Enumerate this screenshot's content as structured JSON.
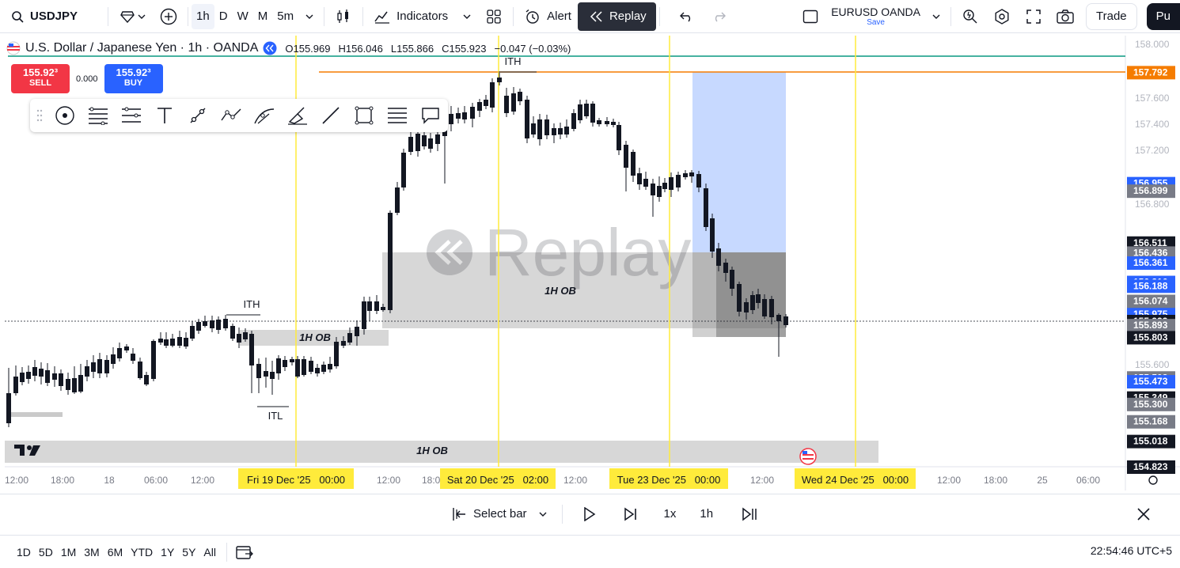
{
  "topbar": {
    "symbol": "USDJPY",
    "timeframes": [
      "1h",
      "D",
      "W",
      "M",
      "5m"
    ],
    "indicators_label": "Indicators",
    "alert_label": "Alert",
    "replay_label": "Replay",
    "compare_symbol": "EURUSD OANDA",
    "compare_save": "Save",
    "trade_label": "Trade",
    "publish_label": "Pu"
  },
  "legend": {
    "title": "U.S. Dollar / Japanese Yen · 1h · OANDA",
    "open": "O155.969",
    "high": "H156.046",
    "low": "L155.866",
    "close": "C155.923",
    "change": "−0.047 (−0.03%)"
  },
  "order": {
    "sell_price": "155.92³",
    "sell_label": "SELL",
    "spread": "0.000",
    "buy_price": "155.92³",
    "buy_label": "BUY"
  },
  "watermark": "Replay",
  "chart_data": {
    "type": "candlestick",
    "ylim": [
      154.823,
      158.0
    ],
    "y_ticks": [
      "158.000",
      "157.600",
      "157.400",
      "157.200",
      "156.800",
      "155.600"
    ],
    "price_labels": [
      {
        "value": "157.792",
        "color": "#f57c00"
      },
      {
        "value": "156.955",
        "color": "#2962ff"
      },
      {
        "value": "156.899",
        "color": "#787b86"
      },
      {
        "value": "156.511",
        "color": "#131722"
      },
      {
        "value": "156.436",
        "color": "#787b86"
      },
      {
        "value": "156.361",
        "color": "#2962ff"
      },
      {
        "value": "156.216",
        "color": "#2962ff"
      },
      {
        "value": "156.188",
        "color": "#2962ff"
      },
      {
        "value": "156.074",
        "color": "#787b86"
      },
      {
        "value": "155.975",
        "color": "#2962ff"
      },
      {
        "value": "155.923",
        "color": "#131722"
      },
      {
        "value": "155.893",
        "color": "#787b86"
      },
      {
        "value": "155.803",
        "color": "#131722"
      },
      {
        "value": "155.502",
        "color": "#787b86"
      },
      {
        "value": "155.473",
        "color": "#2962ff"
      },
      {
        "value": "155.349",
        "color": "#131722"
      },
      {
        "value": "155.300",
        "color": "#787b86"
      },
      {
        "value": "155.168",
        "color": "#787b86"
      },
      {
        "value": "155.018",
        "color": "#131722"
      },
      {
        "value": "154.823",
        "color": "#131722"
      }
    ],
    "x_ticks": [
      "12:00",
      "18:00",
      "18",
      "06:00",
      "12:00",
      "12:00",
      "18:00",
      "12:00",
      "12:00",
      "12:00",
      "18:00",
      "25",
      "06:00"
    ],
    "highlighted_dates": [
      "Fri 19 Dec '25   00:00",
      "Sat 20 Dec '25   02:00",
      "Tue 23 Dec '25   00:00",
      "Wed 24 Dec '25   00:00"
    ],
    "annotations": [
      "ITH",
      "ITH",
      "ITL",
      "1H OB",
      "1H OB",
      "1H OB"
    ],
    "colors": {
      "up": "#2962ff",
      "down": "#131722",
      "vline": "#ffeb3b",
      "hline_orange": "#f57c00",
      "hline_green": "#089981"
    }
  },
  "replay_controls": {
    "select_bar": "Select bar",
    "speed": "1x",
    "interval": "1h"
  },
  "ranges": [
    "1D",
    "5D",
    "1M",
    "3M",
    "6M",
    "YTD",
    "1Y",
    "5Y",
    "All"
  ],
  "clock": "22:54:46 UTC+5"
}
